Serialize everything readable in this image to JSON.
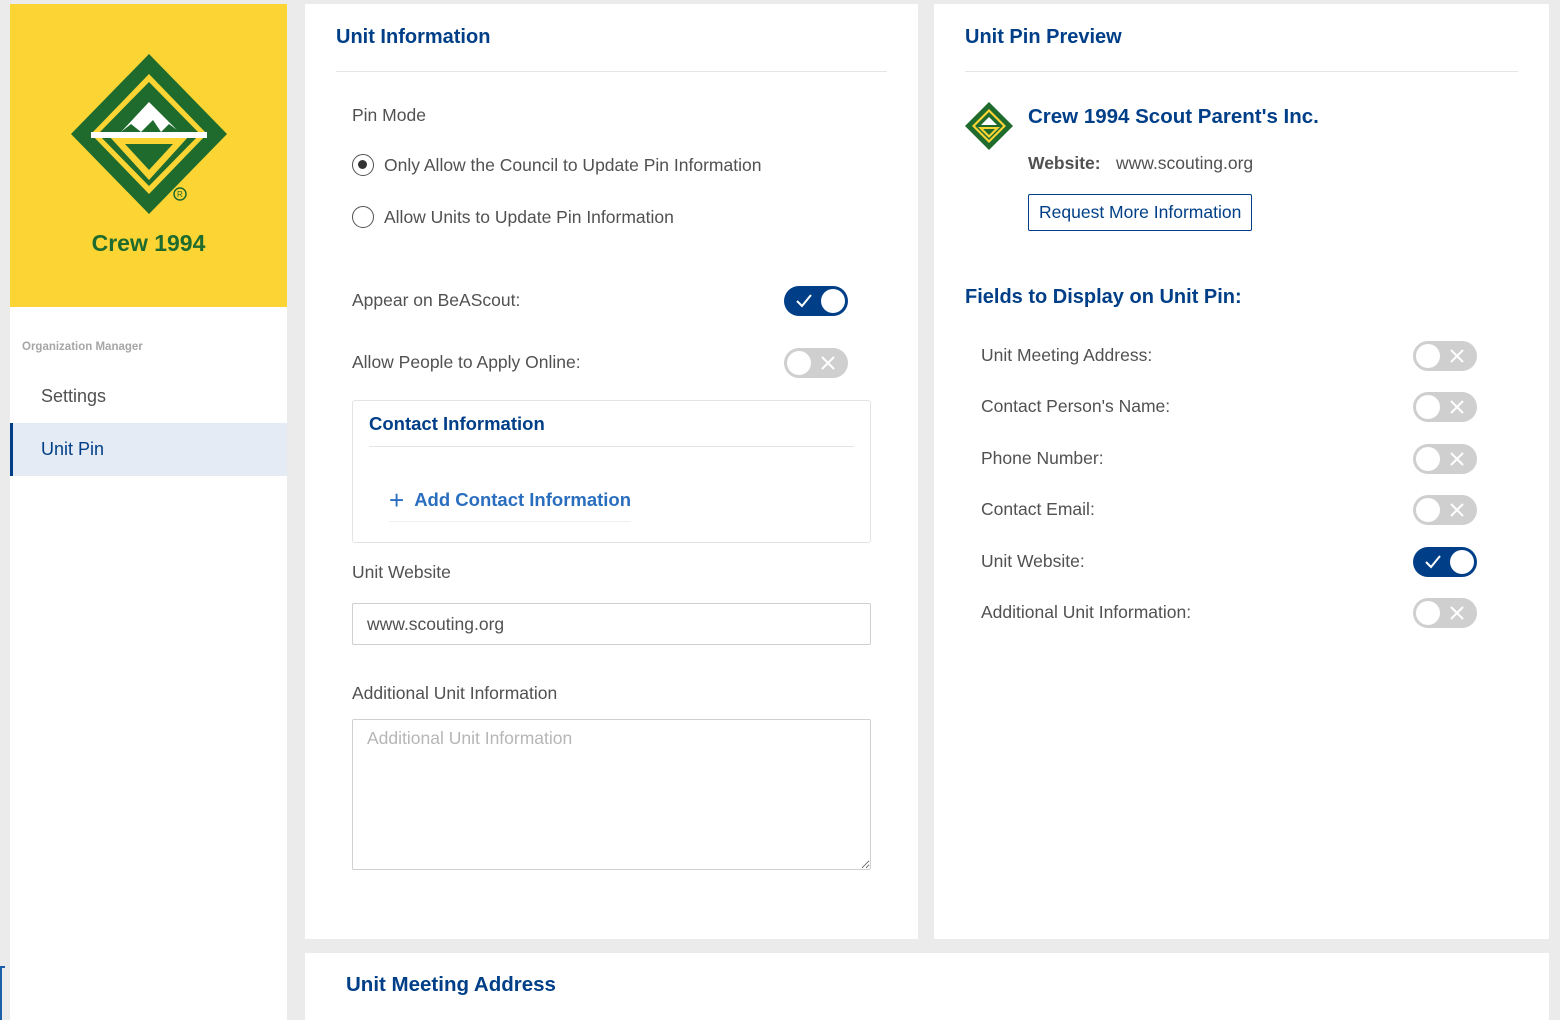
{
  "org": {
    "name": "Crew 1994",
    "logo_icon": "venturing-emblem-icon",
    "brand_yellow": "#fcd535",
    "brand_green": "#1f6b2e"
  },
  "sidebar": {
    "section_label": "Organization Manager",
    "items": [
      {
        "label": "Settings",
        "active": false
      },
      {
        "label": "Unit Pin",
        "active": true
      }
    ]
  },
  "unit_info": {
    "title": "Unit Information",
    "pin_mode_label": "Pin Mode",
    "pin_mode_options": [
      {
        "label": "Only Allow the Council to Update Pin Information",
        "checked": true
      },
      {
        "label": "Allow Units to Update Pin Information",
        "checked": false
      }
    ],
    "appear_label": "Appear on BeAScout",
    "appear_on": true,
    "apply_label": "Allow People to Apply Online",
    "apply_on": false,
    "contact_title": "Contact Information",
    "add_contact_label": "Add Contact Information",
    "website_label": "Unit Website",
    "website_value": "www.scouting.org",
    "additional_label": "Additional Unit Information",
    "additional_placeholder": "Additional Unit Information"
  },
  "preview": {
    "title": "Unit Pin Preview",
    "org_name": "Crew 1994 Scout Parent's Inc.",
    "website_label": "Website:",
    "website_value": "www.scouting.org",
    "request_button": "Request More Information",
    "fields_title": "Fields to Display on Unit Pin:",
    "fields": [
      {
        "label": "Unit Meeting Address",
        "on": false
      },
      {
        "label": "Contact Person's Name",
        "on": false
      },
      {
        "label": "Phone Number",
        "on": false
      },
      {
        "label": "Contact Email",
        "on": false
      },
      {
        "label": "Unit Website",
        "on": true
      },
      {
        "label": "Additional Unit Information",
        "on": false
      }
    ]
  },
  "meeting": {
    "title": "Unit Meeting Address"
  },
  "colors": {
    "accent": "#003f87",
    "link": "#2a6ebf",
    "toggle_off": "#cfcfcf"
  }
}
